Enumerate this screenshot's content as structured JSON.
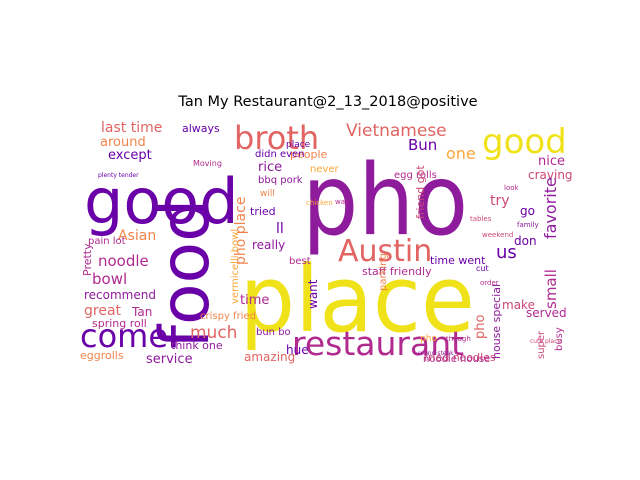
{
  "title": "Tan My Restaurant@2_13_2018@positive",
  "palette": {
    "dark_purple": "#6a00a8",
    "purple": "#8e1a9c",
    "magenta": "#b12a90",
    "pink": "#cc4778",
    "coral": "#e16462",
    "orange": "#f2844b",
    "gold": "#fca636",
    "yellow": "#f0e219"
  },
  "words": [
    {
      "text": "pho",
      "color": "#8e1a9c"
    },
    {
      "text": "place",
      "color": "#f0e219"
    },
    {
      "text": "food",
      "color": "#6a00a8"
    },
    {
      "text": "good",
      "color": "#6a00a8"
    },
    {
      "text": "good",
      "color": "#f0e219"
    },
    {
      "text": "broth",
      "color": "#e16462"
    },
    {
      "text": "come",
      "color": "#6a00a8"
    },
    {
      "text": "restaurant",
      "color": "#b12a90"
    },
    {
      "text": "Austin",
      "color": "#e16462"
    },
    {
      "text": "Vietnamese",
      "color": "#e16462"
    },
    {
      "text": "much",
      "color": "#e16462"
    },
    {
      "text": "noodle",
      "color": "#b12a90"
    },
    {
      "text": "Asian",
      "color": "#f2844b"
    },
    {
      "text": "bowl",
      "color": "#b12a90"
    },
    {
      "text": "us",
      "color": "#6a00a8"
    },
    {
      "text": "Bun",
      "color": "#6a00a8"
    },
    {
      "text": "one",
      "color": "#fca636"
    },
    {
      "text": "nice",
      "color": "#b12a90"
    },
    {
      "text": "try",
      "color": "#cc4778"
    },
    {
      "text": "craving",
      "color": "#cc4778"
    },
    {
      "text": "favorite",
      "color": "#8e1a9c"
    },
    {
      "text": "small",
      "color": "#b12a90"
    },
    {
      "text": "served",
      "color": "#b12a90"
    },
    {
      "text": "don",
      "color": "#6a00a8"
    },
    {
      "text": "make",
      "color": "#cc4778"
    },
    {
      "text": "house special",
      "color": "#8e1a9c"
    },
    {
      "text": "super",
      "color": "#cc4778"
    },
    {
      "text": "busy",
      "color": "#b12a90"
    },
    {
      "text": "last time",
      "color": "#e16462"
    },
    {
      "text": "always",
      "color": "#6a00a8"
    },
    {
      "text": "around",
      "color": "#f2844b"
    },
    {
      "text": "except",
      "color": "#6a00a8"
    },
    {
      "text": "pain lot",
      "color": "#b12a90"
    },
    {
      "text": "Pretty",
      "color": "#b12a90"
    },
    {
      "text": "recommend",
      "color": "#8e1a9c"
    },
    {
      "text": "great",
      "color": "#e16462"
    },
    {
      "text": "Tan",
      "color": "#b12a90"
    },
    {
      "text": "spring roll",
      "color": "#b12a90"
    },
    {
      "text": "eggrolls",
      "color": "#f2844b"
    },
    {
      "text": "service",
      "color": "#8e1a9c"
    },
    {
      "text": "think one",
      "color": "#8e1a9c"
    },
    {
      "text": "amazing",
      "color": "#e16462"
    },
    {
      "text": "rice",
      "color": "#8e1a9c"
    },
    {
      "text": "people",
      "color": "#f2844b"
    },
    {
      "text": "didn even",
      "color": "#6a00a8"
    },
    {
      "text": "never",
      "color": "#fca636"
    },
    {
      "text": "egg rolls",
      "color": "#b12a90"
    },
    {
      "text": "bbq pork",
      "color": "#8e1a9c"
    },
    {
      "text": "tried",
      "color": "#6a00a8"
    },
    {
      "text": "really",
      "color": "#8e1a9c"
    },
    {
      "text": "ll",
      "color": "#6a00a8"
    },
    {
      "text": "best",
      "color": "#b12a90"
    },
    {
      "text": "staff friendly",
      "color": "#b12a90"
    },
    {
      "text": "time went",
      "color": "#6a00a8"
    },
    {
      "text": "want",
      "color": "#6a00a8"
    },
    {
      "text": "time",
      "color": "#b12a90"
    },
    {
      "text": "crispy fried",
      "color": "#f2844b"
    },
    {
      "text": "bun bo",
      "color": "#8e1a9c"
    },
    {
      "text": "hue",
      "color": "#6a00a8"
    },
    {
      "text": "fried noodles",
      "color": "#cc4778"
    },
    {
      "text": "noodle house",
      "color": "#b12a90"
    },
    {
      "text": "friend got",
      "color": "#cc4778"
    },
    {
      "text": "parking",
      "color": "#f2844b"
    },
    {
      "text": "pho place",
      "color": "#f2844b"
    },
    {
      "text": "vermicelli bowl",
      "color": "#fca636"
    },
    {
      "text": "pho",
      "color": "#e16462"
    },
    {
      "text": "Moving",
      "color": "#b12a90"
    },
    {
      "text": "plenty tender",
      "color": "#6a00a8"
    },
    {
      "text": "will",
      "color": "#f2844b"
    },
    {
      "text": "go",
      "color": "#6a00a8"
    },
    {
      "text": "pho",
      "color": "#fca636"
    },
    {
      "text": "way",
      "color": "#b12a90"
    },
    {
      "text": "cut",
      "color": "#6a00a8"
    },
    {
      "text": "place",
      "color": "#6a00a8"
    },
    {
      "text": "family",
      "color": "#8e1a9c"
    },
    {
      "text": "weekend",
      "color": "#cc4778"
    },
    {
      "text": "look",
      "color": "#b12a90"
    },
    {
      "text": "tables",
      "color": "#cc4778"
    },
    {
      "text": "though",
      "color": "#b12a90"
    },
    {
      "text": "round steak",
      "color": "#8e1a9c"
    },
    {
      "text": "chicken",
      "color": "#fca636"
    },
    {
      "text": "order",
      "color": "#b12a90"
    },
    {
      "text": "cute place",
      "color": "#cc4778"
    }
  ]
}
